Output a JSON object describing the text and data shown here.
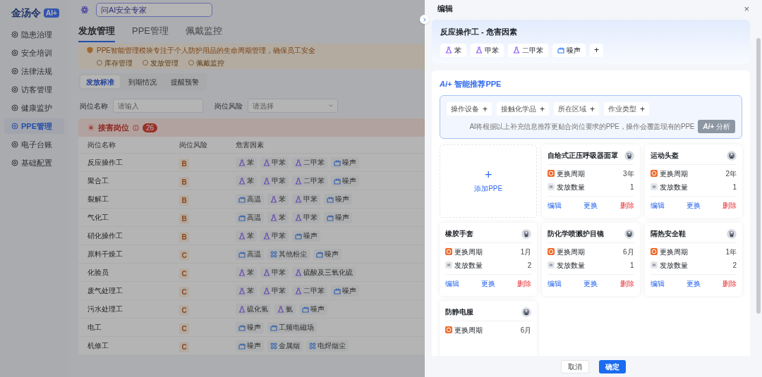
{
  "brand": {
    "name": "金汤令",
    "badge": "AI+"
  },
  "search": {
    "placeholder": "问AI安全专家"
  },
  "sidebar": {
    "items": [
      {
        "label": "隐患治理",
        "selected": false
      },
      {
        "label": "安全培训",
        "selected": false
      },
      {
        "label": "法律法规",
        "selected": false
      },
      {
        "label": "访客管理",
        "selected": false
      },
      {
        "label": "健康监护",
        "selected": false
      },
      {
        "label": "PPE管理",
        "selected": true
      },
      {
        "label": "电子台账",
        "selected": false
      },
      {
        "label": "基础配置",
        "selected": false
      }
    ]
  },
  "tabs": [
    {
      "label": "发放管理",
      "selected": true
    },
    {
      "label": "PPE管理",
      "selected": false
    },
    {
      "label": "佩戴监控",
      "selected": false
    }
  ],
  "banner": {
    "text": "PPE智能管理模块专注于个人防护用品的生命周期管理，确保员工安全",
    "links": [
      "库存管理",
      "发放管理",
      "佩戴监控"
    ]
  },
  "subtabs": [
    {
      "label": "发放标准",
      "selected": true
    },
    {
      "label": "到期情况",
      "selected": false
    },
    {
      "label": "提醒预警",
      "selected": false
    }
  ],
  "filters": [
    {
      "label": "岗位名称",
      "placeholder": "请输入",
      "kind": "input"
    },
    {
      "label": "岗位风险",
      "placeholder": "请选择",
      "kind": "select"
    }
  ],
  "section": {
    "title": "接害岗位",
    "count": "26"
  },
  "table": {
    "columns": [
      "岗位名称",
      "岗位风险",
      "危害因素"
    ],
    "rows": [
      {
        "name": "反应操作工",
        "risk": "B",
        "hazards": [
          {
            "label": "苯",
            "kind": "chemical"
          },
          {
            "label": "甲苯",
            "kind": "chemical"
          },
          {
            "label": "二甲苯",
            "kind": "chemical"
          },
          {
            "label": "噪声",
            "kind": "physical"
          }
        ]
      },
      {
        "name": "聚合工",
        "risk": "B",
        "hazards": [
          {
            "label": "苯",
            "kind": "chemical"
          },
          {
            "label": "甲苯",
            "kind": "chemical"
          },
          {
            "label": "二甲苯",
            "kind": "chemical"
          },
          {
            "label": "噪声",
            "kind": "physical"
          }
        ]
      },
      {
        "name": "裂解工",
        "risk": "B",
        "hazards": [
          {
            "label": "高温",
            "kind": "physical"
          },
          {
            "label": "苯",
            "kind": "chemical"
          },
          {
            "label": "甲苯",
            "kind": "chemical"
          },
          {
            "label": "噪声",
            "kind": "physical"
          }
        ]
      },
      {
        "name": "气化工",
        "risk": "B",
        "hazards": [
          {
            "label": "高温",
            "kind": "physical"
          },
          {
            "label": "苯",
            "kind": "chemical"
          },
          {
            "label": "甲苯",
            "kind": "chemical"
          },
          {
            "label": "噪声",
            "kind": "physical"
          }
        ]
      },
      {
        "name": "硝化操作工",
        "risk": "B",
        "hazards": [
          {
            "label": "苯",
            "kind": "chemical"
          },
          {
            "label": "甲苯",
            "kind": "chemical"
          },
          {
            "label": "噪声",
            "kind": "physical"
          }
        ]
      },
      {
        "name": "原料干燥工",
        "risk": "C",
        "hazards": [
          {
            "label": "高温",
            "kind": "physical"
          },
          {
            "label": "其他粉尘",
            "kind": "dust"
          },
          {
            "label": "噪声",
            "kind": "physical"
          }
        ]
      },
      {
        "name": "化验员",
        "risk": "C",
        "hazards": [
          {
            "label": "苯",
            "kind": "chemical"
          },
          {
            "label": "甲苯",
            "kind": "chemical"
          },
          {
            "label": "硫酸及三氧化硫",
            "kind": "chemical"
          }
        ]
      },
      {
        "name": "废气处理工",
        "risk": "C",
        "hazards": [
          {
            "label": "苯",
            "kind": "chemical"
          },
          {
            "label": "甲苯",
            "kind": "chemical"
          },
          {
            "label": "二甲苯",
            "kind": "chemical"
          },
          {
            "label": "噪声",
            "kind": "physical"
          }
        ]
      },
      {
        "name": "污水处理工",
        "risk": "C",
        "hazards": [
          {
            "label": "硫化氢",
            "kind": "chemical"
          },
          {
            "label": "氨",
            "kind": "chemical"
          },
          {
            "label": "噪声",
            "kind": "physical"
          }
        ]
      },
      {
        "name": "电工",
        "risk": "C",
        "hazards": [
          {
            "label": "噪声",
            "kind": "physical"
          },
          {
            "label": "工频电磁场",
            "kind": "physical"
          }
        ]
      },
      {
        "name": "机修工",
        "risk": "C",
        "hazards": [
          {
            "label": "噪声",
            "kind": "physical"
          },
          {
            "label": "金属烟",
            "kind": "dust"
          },
          {
            "label": "电焊烟尘",
            "kind": "dust"
          }
        ]
      }
    ]
  },
  "drawer": {
    "title": "编辑",
    "close": "×",
    "hazard_card": {
      "title": "反应操作工 - 危害因素",
      "tags": [
        {
          "label": "苯",
          "kind": "chemical"
        },
        {
          "label": "甲苯",
          "kind": "chemical"
        },
        {
          "label": "二甲苯",
          "kind": "chemical"
        },
        {
          "label": "噪声",
          "kind": "physical"
        }
      ],
      "add": "+"
    },
    "recommend": {
      "logo": "Ai+",
      "title": "智能推荐PPE",
      "chips": [
        "操作设备",
        "接触化学品",
        "所在区域",
        "作业类型"
      ],
      "hint": "AI将根据以上补充信息推荐更贴合岗位要求的PPE，操作会覆盖现有的PPE",
      "button": {
        "logo": "Ai+",
        "label": "分析",
        "disabled": true
      }
    },
    "add_card": {
      "icon": "+",
      "label": "添加PPE"
    },
    "ppe": [
      {
        "name": "自给式正压呼吸器面罩",
        "cycle_label": "更换周期",
        "cycle": "3年",
        "qty_label": "发放数量",
        "qty": "1",
        "actions": [
          "编辑",
          "更换",
          "删除"
        ]
      },
      {
        "name": "运动头盔",
        "cycle_label": "更换周期",
        "cycle": "2年",
        "qty_label": "发放数量",
        "qty": "1",
        "actions": [
          "编辑",
          "更换",
          "删除"
        ]
      },
      {
        "name": "橡胶手套",
        "cycle_label": "更换周期",
        "cycle": "1月",
        "qty_label": "发放数量",
        "qty": "2",
        "actions": [
          "编辑",
          "更换",
          "删除"
        ]
      },
      {
        "name": "防化学喷溅护目镜",
        "cycle_label": "更换周期",
        "cycle": "6月",
        "qty_label": "发放数量",
        "qty": "1",
        "actions": [
          "编辑",
          "更换",
          "删除"
        ]
      },
      {
        "name": "隔热安全鞋",
        "cycle_label": "更换周期",
        "cycle": "1年",
        "qty_label": "发放数量",
        "qty": "2",
        "actions": [
          "编辑",
          "更换",
          "删除"
        ]
      },
      {
        "name": "防静电服",
        "cycle_label": "更换周期",
        "cycle": "6月"
      }
    ],
    "footer": {
      "cancel": "取消",
      "ok": "确定"
    }
  }
}
